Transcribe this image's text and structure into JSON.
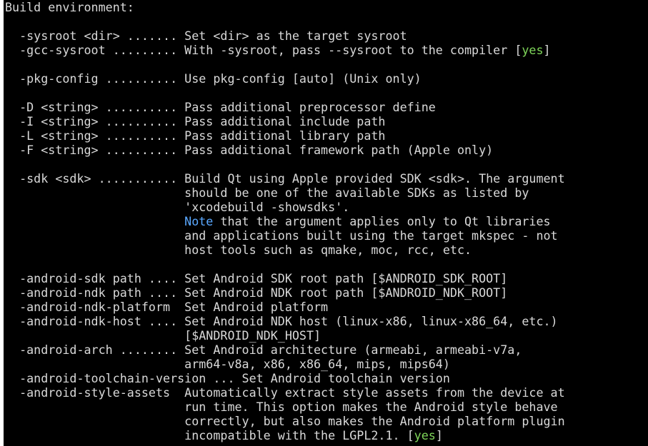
{
  "terminal": {
    "lines": [
      {
        "segments": [
          {
            "text": "Build environment:",
            "c": "fg"
          }
        ]
      },
      {
        "segments": [
          {
            "text": "",
            "c": "fg"
          }
        ]
      },
      {
        "segments": [
          {
            "text": "  -sysroot <dir> ....... Set <dir> as the target sysroot",
            "c": "fg"
          }
        ]
      },
      {
        "segments": [
          {
            "text": "  -gcc-sysroot ......... With -sysroot, pass --sysroot to the compiler [",
            "c": "fg"
          },
          {
            "text": "yes",
            "c": "green"
          },
          {
            "text": "]",
            "c": "fg"
          }
        ]
      },
      {
        "segments": [
          {
            "text": "",
            "c": "fg"
          }
        ]
      },
      {
        "segments": [
          {
            "text": "  -pkg-config .......... Use pkg-config [auto] (Unix only)",
            "c": "fg"
          }
        ]
      },
      {
        "segments": [
          {
            "text": "",
            "c": "fg"
          }
        ]
      },
      {
        "segments": [
          {
            "text": "  -D <string> .......... Pass additional preprocessor define",
            "c": "fg"
          }
        ]
      },
      {
        "segments": [
          {
            "text": "  -I <string> .......... Pass additional include path",
            "c": "fg"
          }
        ]
      },
      {
        "segments": [
          {
            "text": "  -L <string> .......... Pass additional library path",
            "c": "fg"
          }
        ]
      },
      {
        "segments": [
          {
            "text": "  -F <string> .......... Pass additional framework path (Apple only)",
            "c": "fg"
          }
        ]
      },
      {
        "segments": [
          {
            "text": "",
            "c": "fg"
          }
        ]
      },
      {
        "segments": [
          {
            "text": "  -sdk <sdk> ........... Build Qt using Apple provided SDK <sdk>. The argument",
            "c": "fg"
          }
        ]
      },
      {
        "segments": [
          {
            "text": "                         should be one of the available SDKs as listed by",
            "c": "fg"
          }
        ]
      },
      {
        "segments": [
          {
            "text": "                         'xcodebuild -showsdks'.",
            "c": "fg"
          }
        ]
      },
      {
        "segments": [
          {
            "text": "                         ",
            "c": "fg"
          },
          {
            "text": "Note",
            "c": "blue"
          },
          {
            "text": " that the argument applies only to Qt libraries",
            "c": "fg"
          }
        ]
      },
      {
        "segments": [
          {
            "text": "                         and applications built using the target mkspec - not",
            "c": "fg"
          }
        ]
      },
      {
        "segments": [
          {
            "text": "                         host tools such as qmake, moc, rcc, etc.",
            "c": "fg"
          }
        ]
      },
      {
        "segments": [
          {
            "text": "",
            "c": "fg"
          }
        ]
      },
      {
        "segments": [
          {
            "text": "  -android-sdk path .... Set Android SDK root path [$ANDROID_SDK_ROOT]",
            "c": "fg"
          }
        ]
      },
      {
        "segments": [
          {
            "text": "  -android-ndk path .... Set Android NDK root path [$ANDROID_NDK_ROOT]",
            "c": "fg"
          }
        ]
      },
      {
        "segments": [
          {
            "text": "  -android-ndk-platform  Set Android platform",
            "c": "fg"
          }
        ]
      },
      {
        "segments": [
          {
            "text": "  -android-ndk-host .... Set Android NDK host (linux-x86, linux-x86_64, etc.)",
            "c": "fg"
          }
        ]
      },
      {
        "segments": [
          {
            "text": "                         [$ANDROID_NDK_HOST]",
            "c": "fg"
          }
        ]
      },
      {
        "segments": [
          {
            "text": "  -android-arch ........ Set Android architecture (armeabi, armeabi-v7a,",
            "c": "fg"
          }
        ]
      },
      {
        "segments": [
          {
            "text": "                         arm64-v8a, x86, x86_64, mips, mips64)",
            "c": "fg"
          }
        ]
      },
      {
        "segments": [
          {
            "text": "  -android-toolchain-version ... Set Android toolchain version",
            "c": "fg"
          }
        ]
      },
      {
        "segments": [
          {
            "text": "  -android-style-assets  Automatically extract style assets from the device at",
            "c": "fg"
          }
        ]
      },
      {
        "segments": [
          {
            "text": "                         run time. This option makes the Android style behave",
            "c": "fg"
          }
        ]
      },
      {
        "segments": [
          {
            "text": "                         correctly, but also makes the Android platform plugin",
            "c": "fg"
          }
        ]
      },
      {
        "segments": [
          {
            "text": "                         incompatible with the LGPL2.1. [",
            "c": "fg"
          },
          {
            "text": "yes",
            "c": "green"
          },
          {
            "text": "]",
            "c": "fg"
          }
        ]
      }
    ]
  }
}
